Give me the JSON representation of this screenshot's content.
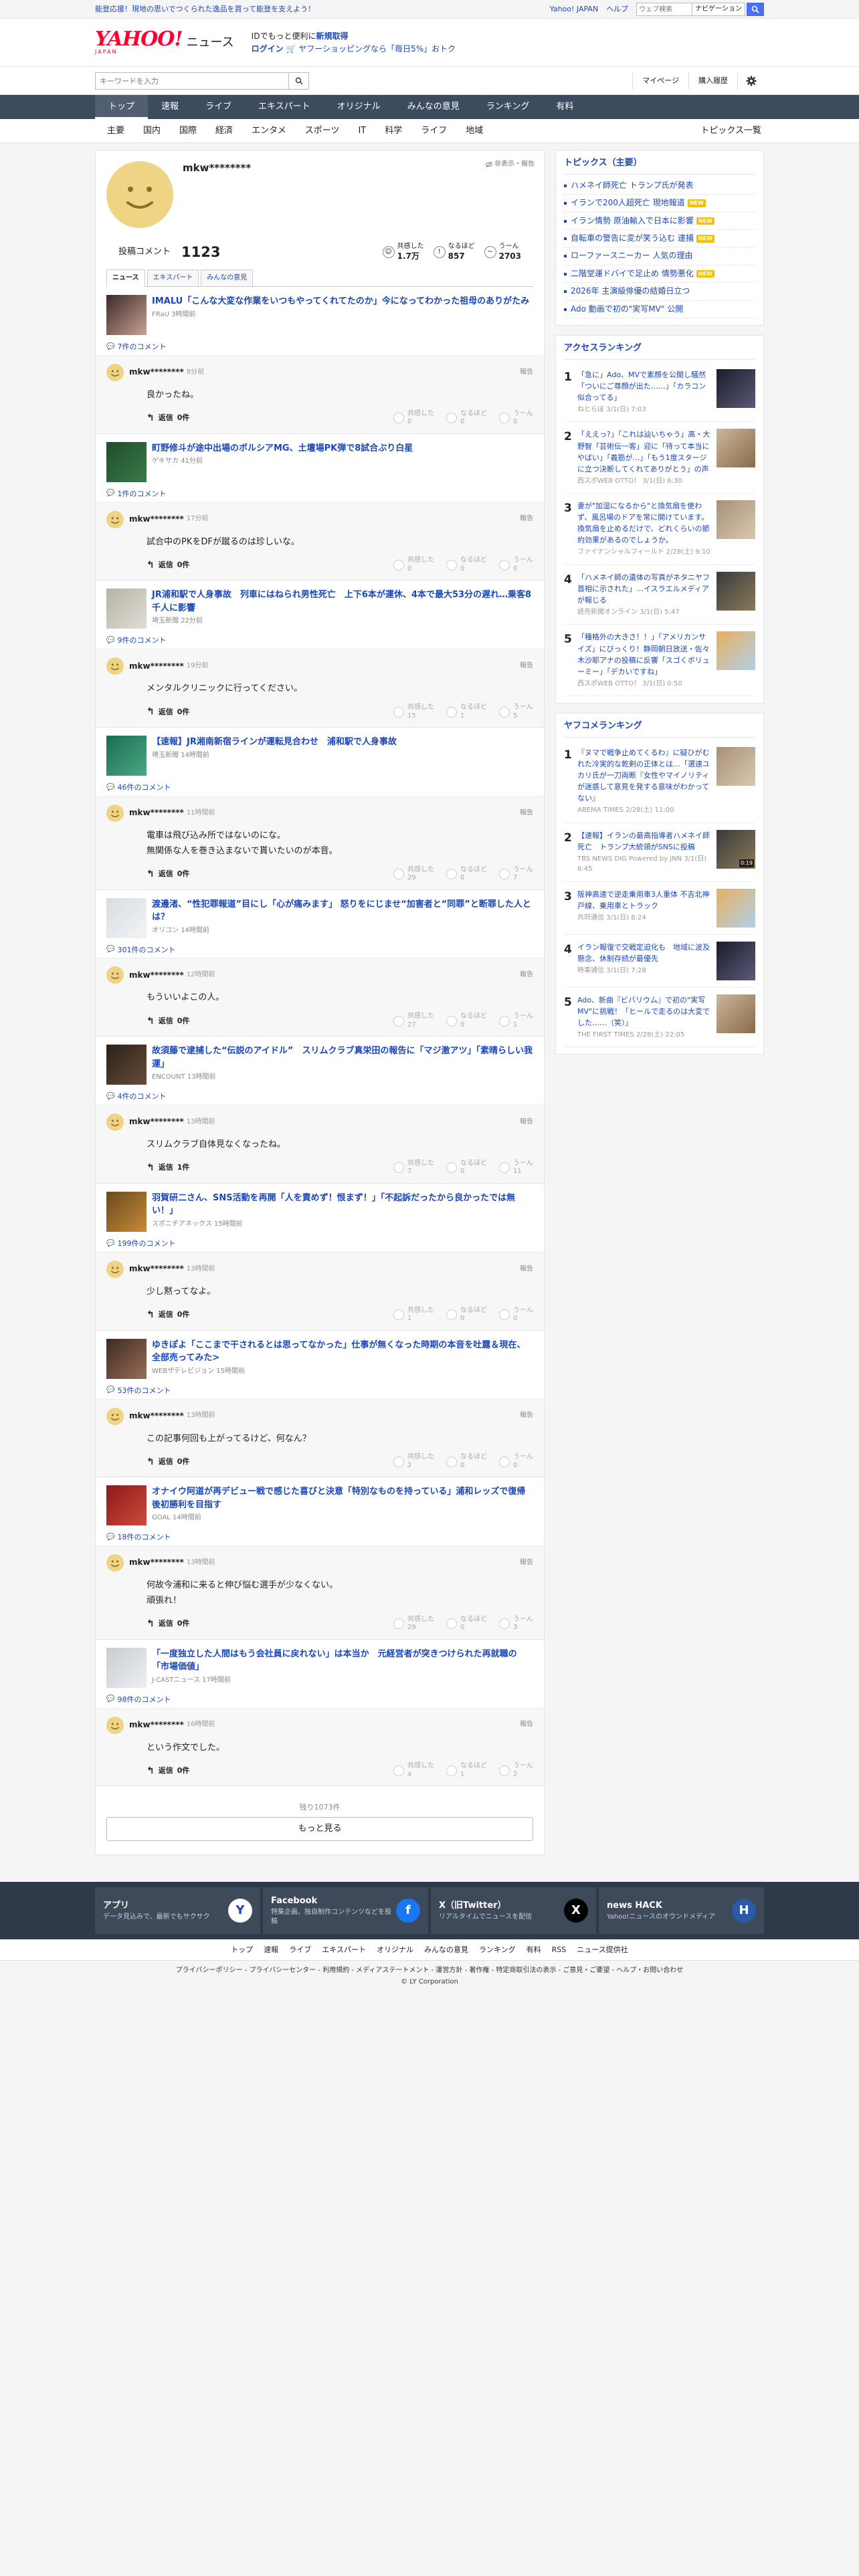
{
  "topbar": {
    "promo": "能登応援！現地の思いでつくられた逸品を買って能登を支えよう！",
    "yahoo_link": "Yahoo! JAPAN",
    "help_link": "ヘルプ",
    "search_placeholder": "ウェブ検索",
    "nav_chip": "ナビゲーション"
  },
  "header": {
    "logo_text": "YAHOO!",
    "logo_sub": "JAPAN",
    "logo_news": "ニュース",
    "info_line1": "IDでもっと便利に",
    "info_new": "新規取得",
    "login": "ログイン",
    "shopping": "ヤフーショッピングなら「毎日5%」おトク"
  },
  "searchrow": {
    "placeholder": "キーワードを入力",
    "mypage": "マイページ",
    "purchase": "購入履歴"
  },
  "gnav": [
    "トップ",
    "速報",
    "ライブ",
    "エキスパート",
    "オリジナル",
    "みんなの意見",
    "ランキング",
    "有料"
  ],
  "subnav": [
    "主要",
    "国内",
    "国際",
    "経済",
    "エンタメ",
    "スポーツ",
    "IT",
    "科学",
    "ライフ",
    "地域"
  ],
  "subnav_topics": "トピックス一覧",
  "profile": {
    "name": "mkw********",
    "hide": "非表示・報告",
    "posted_label": "投稿コメント",
    "posted_count": "1123",
    "reactions": [
      {
        "label": "共感した",
        "value": "1.7万"
      },
      {
        "label": "なるほど",
        "value": "857"
      },
      {
        "label": "うーん",
        "value": "2703"
      }
    ],
    "tabs": [
      "ニュース",
      "エキスパート",
      "みんなの意見"
    ]
  },
  "labels": {
    "reply": "返信",
    "report": "報告",
    "agree": "共感した",
    "understand": "なるほど",
    "hmm": "うーん"
  },
  "items": [
    {
      "title": "IMALU「こんな大変な作業をいつもやってくれてたのか」今になってわかった祖母のありがたみ",
      "source": "FRaU",
      "time": "3時間前",
      "comments": "7件のコメント",
      "user": "mkw********",
      "ctime": "8分前",
      "body": "良かったね。",
      "replies": "0件",
      "v": [
        "0",
        "0",
        "0"
      ]
    },
    {
      "title": "町野修斗が途中出場のボルシアMG、土壇場PK弾で8試合ぶり白星",
      "source": "ゲキサカ",
      "time": "41分前",
      "comments": "1件のコメント",
      "user": "mkw********",
      "ctime": "17分前",
      "body": "試合中のPKをDFが蹴るのは珍しいな。",
      "replies": "0件",
      "v": [
        "0",
        "0",
        "0"
      ]
    },
    {
      "title": "JR浦和駅で人身事故　列車にはねられ男性死亡　上下6本が運休、4本で最大53分の遅れ…乗客8千人に影響",
      "source": "埼玉新聞",
      "time": "22分前",
      "comments": "9件のコメント",
      "user": "mkw********",
      "ctime": "19分前",
      "body": "メンタルクリニックに行ってください。",
      "replies": "0件",
      "v": [
        "15",
        "1",
        "5"
      ]
    },
    {
      "title": "【速報】JR湘南新宿ラインが運転見合わせ　浦和駅で人身事故",
      "source": "埼玉新聞",
      "time": "14時間前",
      "comments": "46件のコメント",
      "user": "mkw********",
      "ctime": "11時間前",
      "body": "電車は飛び込み所ではないのにな。\n無関係な人を巻き込まないで貰いたいのが本音。",
      "replies": "0件",
      "v": [
        "29",
        "0",
        "7"
      ]
    },
    {
      "title": "渡邊渚、“性犯罪報道”目にし「心が痛みます」 怒りをにじませ“加害者と“同罪”と断罪した人とは？",
      "source": "オリコン",
      "time": "14時間前",
      "comments": "301件のコメント",
      "user": "mkw********",
      "ctime": "12時間前",
      "body": "もういいよこの人。",
      "replies": "0件",
      "v": [
        "27",
        "0",
        "1"
      ]
    },
    {
      "title": "故須藤で逮捕した“伝説のアイドル”　スリムクラブ真栄田の報告に「マジ激アツ」「素晴らしい我運」",
      "source": "ENCOUNT",
      "time": "13時間前",
      "comments": "4件のコメント",
      "user": "mkw********",
      "ctime": "13時間前",
      "body": "スリムクラブ自体見なくなったね。",
      "replies": "1件",
      "v": [
        "7",
        "0",
        "11"
      ]
    },
    {
      "title": "羽賀研二さん、SNS活動を再開「人を責めず！恨まず！」「不起訴だったから良かったでは無い！」",
      "source": "スポニチアネックス",
      "time": "15時間前",
      "comments": "199件のコメント",
      "user": "mkw********",
      "ctime": "13時間前",
      "body": "少し黙ってなよ。",
      "replies": "0件",
      "v": [
        "1",
        "0",
        "0"
      ]
    },
    {
      "title": "ゆきぽよ「ここまで干されるとは思ってなかった」仕事が無くなった時期の本音を吐露＆現在、全部売ってみた>",
      "source": "WEBザテレビジョン",
      "time": "15時間前",
      "comments": "53件のコメント",
      "user": "mkw********",
      "ctime": "13時間前",
      "body": "この記事何回も上がってるけど、何なん？",
      "replies": "0件",
      "v": [
        "2",
        "0",
        "0"
      ]
    },
    {
      "title": "オナイウ阿道が再デビュー戦で感じた喜びと決意「特別なものを持っている」浦和レッズで復帰後初勝利を目指す",
      "source": "GOAL",
      "time": "14時間前",
      "comments": "18件のコメント",
      "user": "mkw********",
      "ctime": "13時間前",
      "body": "何故今浦和に来ると伸び悩む選手が少なくない。\n頑張れ！",
      "replies": "0件",
      "v": [
        "29",
        "0",
        "3"
      ]
    },
    {
      "title": "「一度独立した人間はもう会社員に戻れない」は本当か　元経営者が突きつけられた再就職の「市場価値」",
      "source": "J-CASTニュース",
      "time": "17時間前",
      "comments": "98件のコメント",
      "user": "mkw********",
      "ctime": "16時間前",
      "body": "という作文でした。",
      "replies": "0件",
      "v": [
        "4",
        "1",
        "2"
      ]
    }
  ],
  "more": {
    "rest": "残り1073件",
    "button": "もっと見る"
  },
  "topics": {
    "heading": "トピックス（主要）",
    "items": [
      {
        "text": "ハメネイ師死亡 トランプ氏が発表",
        "new": false
      },
      {
        "text": "イランで200人超死亡 現地報道",
        "new": true
      },
      {
        "text": "イラン情勢 原油輸入で日本に影響",
        "new": true
      },
      {
        "text": "自転車の警告に変が笑う込む 逮捕",
        "new": true
      },
      {
        "text": "ローファースニーカー 人気の理由",
        "new": false
      },
      {
        "text": "二階堂運ドバイで足止め 情勢悪化",
        "new": true
      },
      {
        "text": "2026年 主演級俳優の結婚日立つ",
        "new": false
      },
      {
        "text": "Ado 動画で初の\"実写MV\" 公開",
        "new": false
      }
    ],
    "new_label": "NEW"
  },
  "access": {
    "heading": "アクセスランキング",
    "items": [
      {
        "rank": "1",
        "title": "「急に」Ado、MVで素顔を公開し騒然「ついにご尊顔が出た……」「カラコン似合ってる」",
        "meta": "ねとらぼ 3/1(日) 7:03"
      },
      {
        "rank": "2",
        "title": "「ええっ?」「これは辿いちゃう」高・大野智「芸術伝一客」迎に「待って本当にやばい」「義筋が…」「もう1度スタージに立つ決断してくれてありがとう」の声",
        "meta": "西スポWEB OTTO！ 3/1(日) 6:30"
      },
      {
        "rank": "3",
        "title": "妻が\"加湿になるから\"と換気扇を使わず、風呂場のドアを常に開けています。換気扇を止めるだけで、どれくらいの節約効果があるのでしょうか。",
        "meta": "ファイナンシャルフィールド 2/28(土) 9:10"
      },
      {
        "rank": "4",
        "title": "「ハメネイ師の遺体の写真がネタニヤフ首相に示された」…イスラエルメディアが報じる",
        "meta": "読売新聞オンライン 3/1(日) 5:47"
      },
      {
        "rank": "5",
        "title": "「種格外の大きさ！！」「アメリカンサイズ」にびっくり！静岡朝日放送・佐々木沙耶アナの投稿に反響「スゴくボリューミー」「デカいですね」",
        "meta": "西スポWEB OTTO！ 3/1(日) 0:50"
      }
    ]
  },
  "video": {
    "heading": "ヤフコメランキング",
    "items": [
      {
        "rank": "1",
        "title": "『ヌマで戦争止めてくるわ』に疑ひがむれた冷実的な乾剣の正体とは…「選速ユカリ氏が一刀両断『女性やマイノリティが迷惑して意見を発する意味がわかってない』",
        "meta": "ABEMA TIMES 2/28(土) 11:00",
        "dur": ""
      },
      {
        "rank": "2",
        "title": "【速報】イランの最高指導者ハメネイ師死亡　トランプ大統領がSNSに投稿",
        "meta": "TBS NEWS DIG Powered by JNN 3/1(日) 6:45",
        "dur": "0:19"
      },
      {
        "rank": "3",
        "title": "阪神高速で逆走乗用車3人重体 不吉北神戸線、乗用車とトラック",
        "meta": "共同通信 3/1(日) 8:24",
        "dur": ""
      },
      {
        "rank": "4",
        "title": "イラン報復で交戦定迫化も　地域に波及懸念、休制存続が最優先",
        "meta": "時事通信 3/1(日) 7:28",
        "dur": ""
      },
      {
        "rank": "5",
        "title": "Ado、新曲『ビバリウム』で初の\"実写MV\"に挑戦！「ヒールで走るのは大変でした……（笑）」",
        "meta": "THE FIRST TIMES 2/28(土) 22:05",
        "dur": ""
      }
    ]
  },
  "footer": {
    "cards": [
      {
        "title": "アプリ",
        "desc": "データ見込みで、最新でもサクサク",
        "icon": "app-icon"
      },
      {
        "title": "Facebook",
        "desc": "特集企画、独自制作コンテンツなどを投稿",
        "icon": "facebook-icon"
      },
      {
        "title": "X（旧Twitter）",
        "desc": "リアルタイムでニュースを配信",
        "icon": "x-icon"
      },
      {
        "title": "news HACK",
        "desc": "Yahoo!ニュースのオウンドメディア",
        "icon": "newshack-icon"
      }
    ],
    "nav": [
      "トップ",
      "速報",
      "ライブ",
      "エキスパート",
      "オリジナル",
      "みんなの意見",
      "ランキング",
      "有料",
      "RSS",
      "ニュース提供社"
    ],
    "legal": "プライバシーポリシー - プライバシーセンター - 利用規約 - メディアステートメント - 運営方針 - 著作権 - 特定商取引法の表示 - ご意見・ご要望 - ヘルプ・お問い合わせ",
    "copyright": "© LY Corporation"
  },
  "colors": {
    "brand": "#ff0033",
    "link": "#1b47b9",
    "nav": "#3d4b5f",
    "avatar": "#efd485",
    "new_badge": "#f5c000"
  }
}
